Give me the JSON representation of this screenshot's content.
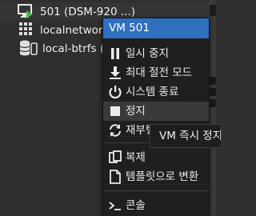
{
  "tree": {
    "items": [
      {
        "label": "501 (DSM-920 ...)",
        "icon": "vm-running-icon"
      },
      {
        "label": "localnetwork",
        "icon": "network-grid-icon"
      },
      {
        "label": "local-btrfs (",
        "icon": "storage-database-icon"
      }
    ]
  },
  "menu": {
    "header": "VM 501",
    "items": [
      {
        "label": "일시 중지",
        "icon": "pause-icon"
      },
      {
        "label": "최대 절전 모드",
        "icon": "download-icon"
      },
      {
        "label": "시스템 종료",
        "icon": "power-icon"
      },
      {
        "label": "정지",
        "icon": "stop-icon"
      },
      {
        "label": "재부팅",
        "icon": "refresh-icon"
      },
      {
        "label": "복제",
        "icon": "clone-icon"
      },
      {
        "label": "템플릿으로 변환",
        "icon": "file-icon"
      },
      {
        "label": "콘솔",
        "icon": "terminal-icon"
      }
    ]
  },
  "tooltip": {
    "text": "VM 즉시 정지"
  },
  "colors": {
    "menu_header_bg": "#2f6fbf",
    "running_green": "#3fbf3f",
    "background": "#303030"
  }
}
